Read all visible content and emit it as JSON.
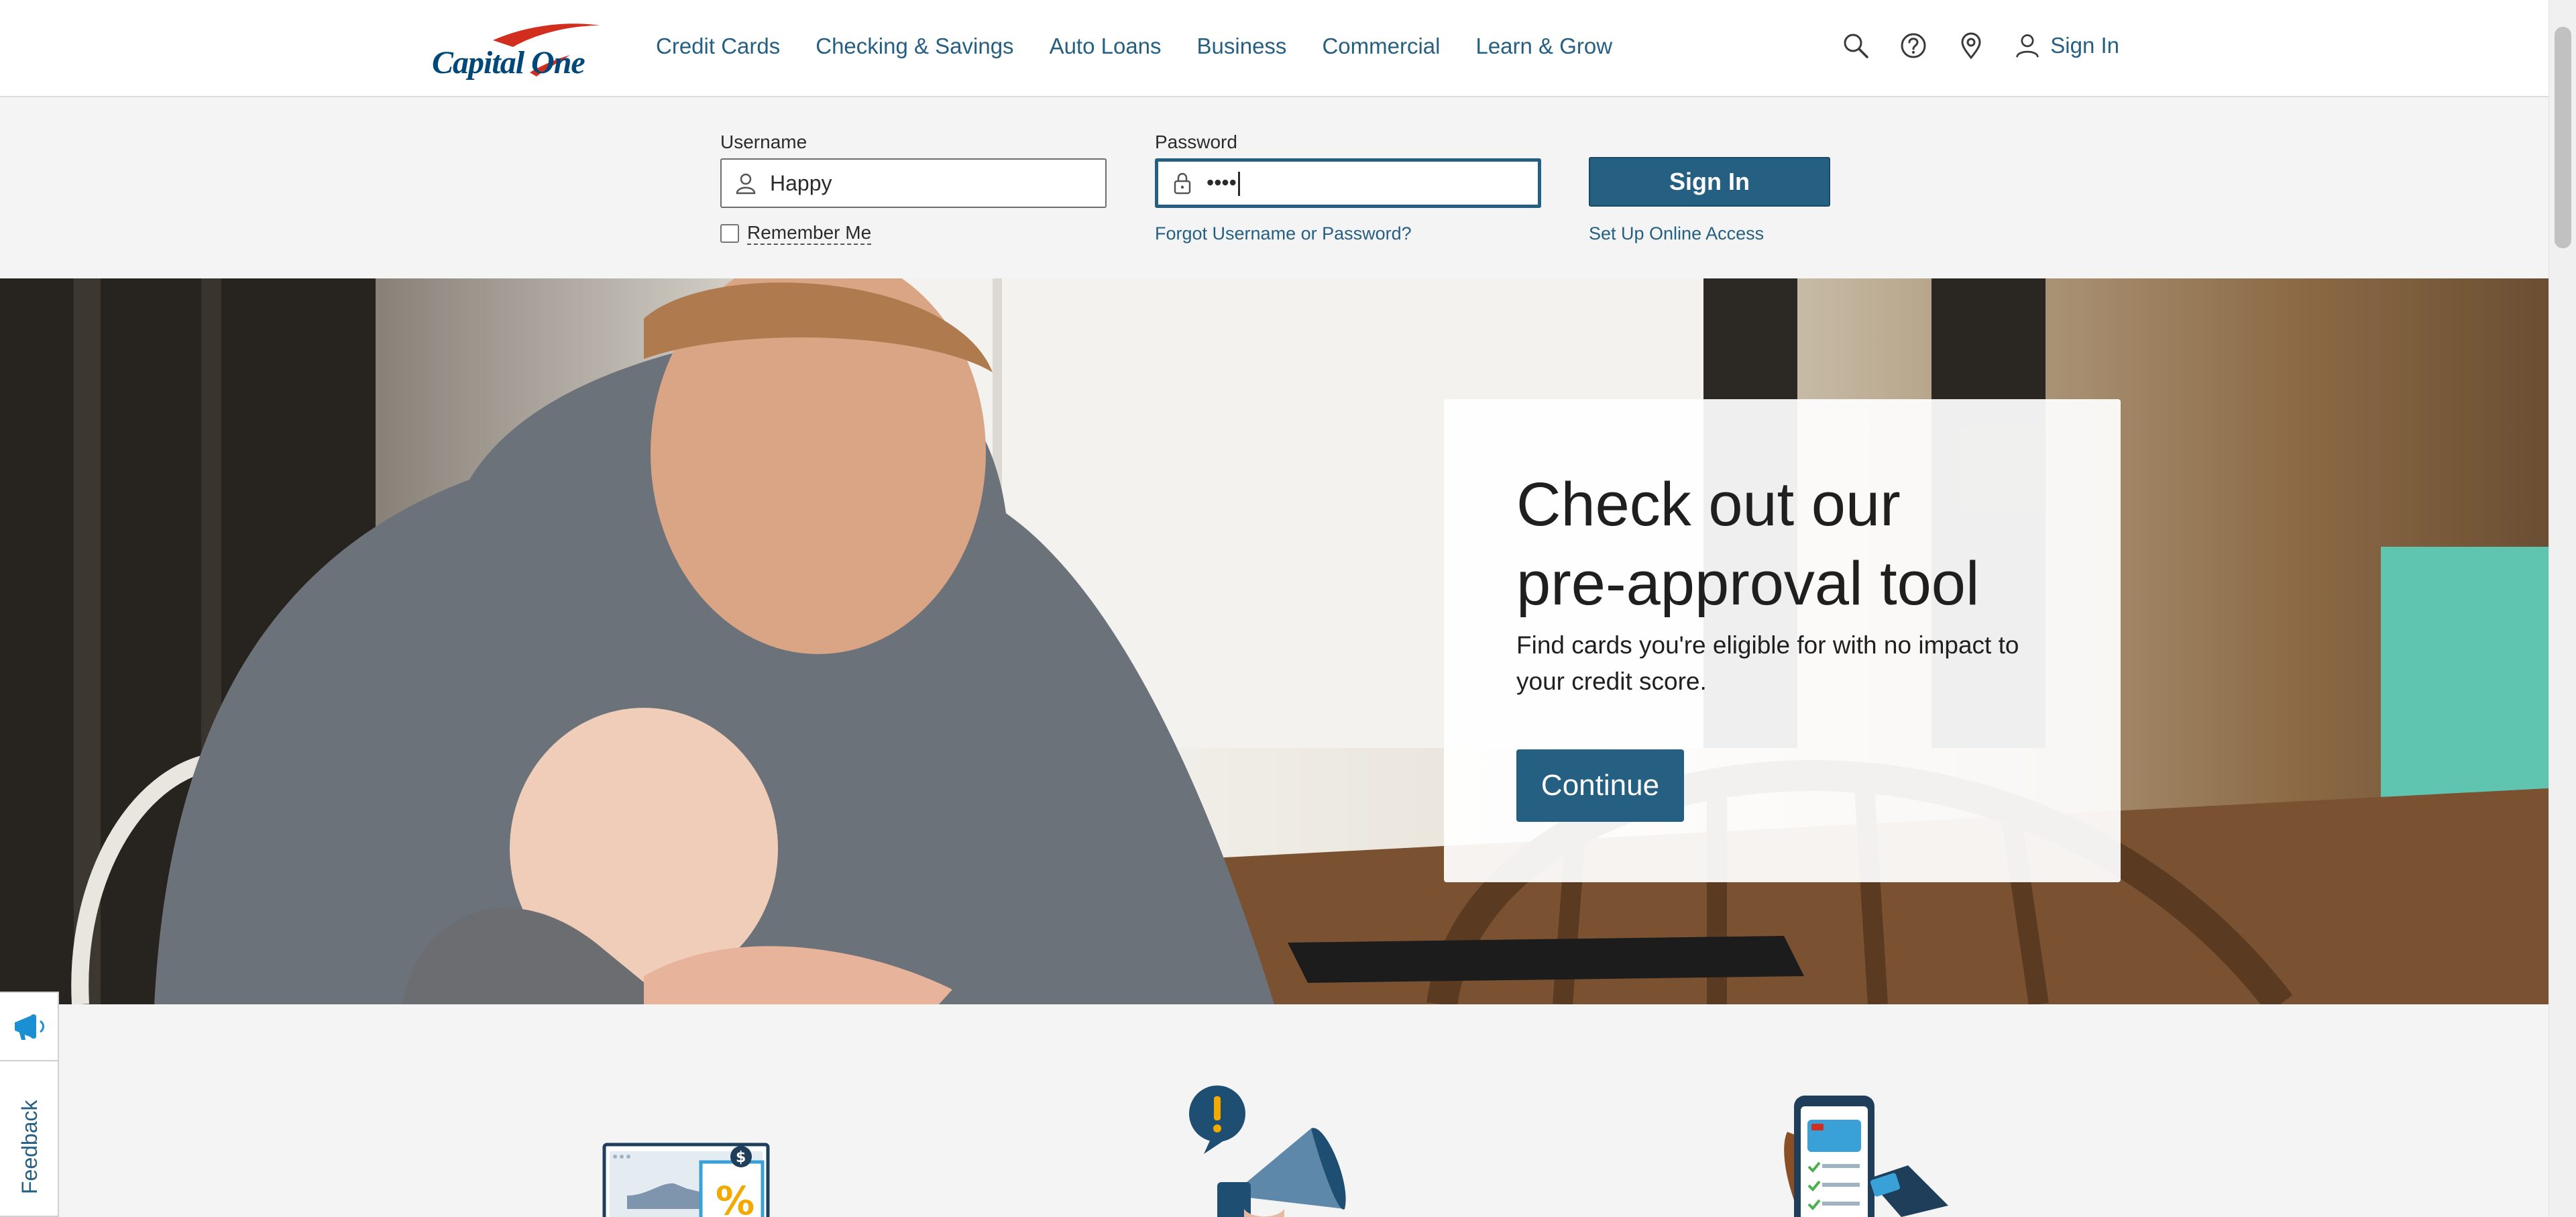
{
  "brand": {
    "logo_text": "Capital One",
    "accent": "#255f82",
    "swoosh": "#d22e1e"
  },
  "nav": {
    "links": [
      "Credit Cards",
      "Checking & Savings",
      "Auto Loans",
      "Business",
      "Commercial",
      "Learn & Grow"
    ],
    "tools": [
      "search-icon",
      "help-icon",
      "location-pin-icon"
    ],
    "sign_in": "Sign In"
  },
  "login": {
    "username_label": "Username",
    "username_value": "Happy",
    "password_label": "Password",
    "password_value": "••••",
    "sign_in_button": "Sign In",
    "remember_me": "Remember Me",
    "forgot_link": "Forgot Username or Password?",
    "setup_link": "Set Up Online Access"
  },
  "hero": {
    "title_line1": "Check out our",
    "title_line2": "pre-approval tool",
    "subtitle": "Find cards you're eligible for with no impact to your credit score.",
    "cta": "Continue"
  },
  "feedback": {
    "label": "Feedback",
    "icon": "megaphone-icon"
  },
  "illustrations": [
    "laptop-shoe-sale-illustration",
    "megaphone-alert-illustration",
    "phone-checklist-illustration"
  ]
}
